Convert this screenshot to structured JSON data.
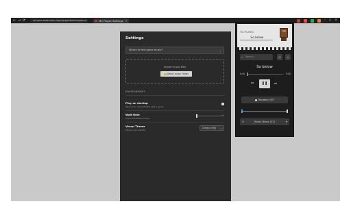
{
  "browser": {
    "nav_icons": [
      "←",
      "→",
      "⟳"
    ],
    "url": "chrome-extension://lpphjcpphbaocldnjdmn/...",
    "tab_title": "MC Player Settings",
    "tab_close": "×",
    "window_controls": [
      "–",
      "▫",
      "×"
    ],
    "extension_colors": [
      "#c0392b",
      "#e74c3c",
      "#27ae60",
      "#e67e22"
    ]
  },
  "settings": {
    "title": "Settings",
    "dropdown_placeholder": "Where to find game music?",
    "import_text": "Import music files",
    "select_folder_label": "Select music Folder",
    "environment_heading": "ENVIRONMENT",
    "play_on_startup": {
      "label": "Play on startup",
      "sub": "Play music when Firefox opens game."
    },
    "wait_time": {
      "label": "Wait time",
      "sub": "Interval between tracks",
      "value": "0s"
    },
    "visual_theme": {
      "label": "Visual Theme",
      "sub": "Player color palette",
      "value": "Classic (Old)"
    }
  },
  "player": {
    "now_playing_label": "YOU PLAYED:",
    "song_title": "So below",
    "search_placeholder": "Search...",
    "track_title": "So below",
    "time_elapsed": "0:00",
    "time_total": "5:10",
    "prev_icon": "⏮",
    "pause_icon": "❚❚",
    "next_icon": "⏭",
    "random_label": "Random OST",
    "playlist_label": "Music Disco (21)",
    "playlist_left": "∨",
    "playlist_right": "▾",
    "search_icon": "⌕",
    "btn1_icon": "⟳",
    "btn2_icon": "≡",
    "progress": 0.0
  }
}
